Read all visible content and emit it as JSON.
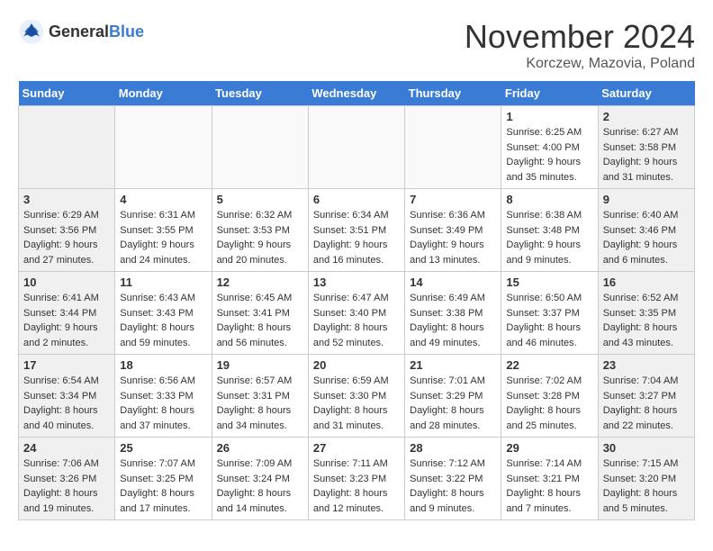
{
  "logo": {
    "general": "General",
    "blue": "Blue"
  },
  "title": {
    "month": "November 2024",
    "location": "Korczew, Mazovia, Poland"
  },
  "weekdays": [
    "Sunday",
    "Monday",
    "Tuesday",
    "Wednesday",
    "Thursday",
    "Friday",
    "Saturday"
  ],
  "weeks": [
    [
      {
        "day": "",
        "info": ""
      },
      {
        "day": "",
        "info": ""
      },
      {
        "day": "",
        "info": ""
      },
      {
        "day": "",
        "info": ""
      },
      {
        "day": "",
        "info": ""
      },
      {
        "day": "1",
        "info": "Sunrise: 6:25 AM\nSunset: 4:00 PM\nDaylight: 9 hours and 35 minutes."
      },
      {
        "day": "2",
        "info": "Sunrise: 6:27 AM\nSunset: 3:58 PM\nDaylight: 9 hours and 31 minutes."
      }
    ],
    [
      {
        "day": "3",
        "info": "Sunrise: 6:29 AM\nSunset: 3:56 PM\nDaylight: 9 hours and 27 minutes."
      },
      {
        "day": "4",
        "info": "Sunrise: 6:31 AM\nSunset: 3:55 PM\nDaylight: 9 hours and 24 minutes."
      },
      {
        "day": "5",
        "info": "Sunrise: 6:32 AM\nSunset: 3:53 PM\nDaylight: 9 hours and 20 minutes."
      },
      {
        "day": "6",
        "info": "Sunrise: 6:34 AM\nSunset: 3:51 PM\nDaylight: 9 hours and 16 minutes."
      },
      {
        "day": "7",
        "info": "Sunrise: 6:36 AM\nSunset: 3:49 PM\nDaylight: 9 hours and 13 minutes."
      },
      {
        "day": "8",
        "info": "Sunrise: 6:38 AM\nSunset: 3:48 PM\nDaylight: 9 hours and 9 minutes."
      },
      {
        "day": "9",
        "info": "Sunrise: 6:40 AM\nSunset: 3:46 PM\nDaylight: 9 hours and 6 minutes."
      }
    ],
    [
      {
        "day": "10",
        "info": "Sunrise: 6:41 AM\nSunset: 3:44 PM\nDaylight: 9 hours and 2 minutes."
      },
      {
        "day": "11",
        "info": "Sunrise: 6:43 AM\nSunset: 3:43 PM\nDaylight: 8 hours and 59 minutes."
      },
      {
        "day": "12",
        "info": "Sunrise: 6:45 AM\nSunset: 3:41 PM\nDaylight: 8 hours and 56 minutes."
      },
      {
        "day": "13",
        "info": "Sunrise: 6:47 AM\nSunset: 3:40 PM\nDaylight: 8 hours and 52 minutes."
      },
      {
        "day": "14",
        "info": "Sunrise: 6:49 AM\nSunset: 3:38 PM\nDaylight: 8 hours and 49 minutes."
      },
      {
        "day": "15",
        "info": "Sunrise: 6:50 AM\nSunset: 3:37 PM\nDaylight: 8 hours and 46 minutes."
      },
      {
        "day": "16",
        "info": "Sunrise: 6:52 AM\nSunset: 3:35 PM\nDaylight: 8 hours and 43 minutes."
      }
    ],
    [
      {
        "day": "17",
        "info": "Sunrise: 6:54 AM\nSunset: 3:34 PM\nDaylight: 8 hours and 40 minutes."
      },
      {
        "day": "18",
        "info": "Sunrise: 6:56 AM\nSunset: 3:33 PM\nDaylight: 8 hours and 37 minutes."
      },
      {
        "day": "19",
        "info": "Sunrise: 6:57 AM\nSunset: 3:31 PM\nDaylight: 8 hours and 34 minutes."
      },
      {
        "day": "20",
        "info": "Sunrise: 6:59 AM\nSunset: 3:30 PM\nDaylight: 8 hours and 31 minutes."
      },
      {
        "day": "21",
        "info": "Sunrise: 7:01 AM\nSunset: 3:29 PM\nDaylight: 8 hours and 28 minutes."
      },
      {
        "day": "22",
        "info": "Sunrise: 7:02 AM\nSunset: 3:28 PM\nDaylight: 8 hours and 25 minutes."
      },
      {
        "day": "23",
        "info": "Sunrise: 7:04 AM\nSunset: 3:27 PM\nDaylight: 8 hours and 22 minutes."
      }
    ],
    [
      {
        "day": "24",
        "info": "Sunrise: 7:06 AM\nSunset: 3:26 PM\nDaylight: 8 hours and 19 minutes."
      },
      {
        "day": "25",
        "info": "Sunrise: 7:07 AM\nSunset: 3:25 PM\nDaylight: 8 hours and 17 minutes."
      },
      {
        "day": "26",
        "info": "Sunrise: 7:09 AM\nSunset: 3:24 PM\nDaylight: 8 hours and 14 minutes."
      },
      {
        "day": "27",
        "info": "Sunrise: 7:11 AM\nSunset: 3:23 PM\nDaylight: 8 hours and 12 minutes."
      },
      {
        "day": "28",
        "info": "Sunrise: 7:12 AM\nSunset: 3:22 PM\nDaylight: 8 hours and 9 minutes."
      },
      {
        "day": "29",
        "info": "Sunrise: 7:14 AM\nSunset: 3:21 PM\nDaylight: 8 hours and 7 minutes."
      },
      {
        "day": "30",
        "info": "Sunrise: 7:15 AM\nSunset: 3:20 PM\nDaylight: 8 hours and 5 minutes."
      }
    ]
  ]
}
